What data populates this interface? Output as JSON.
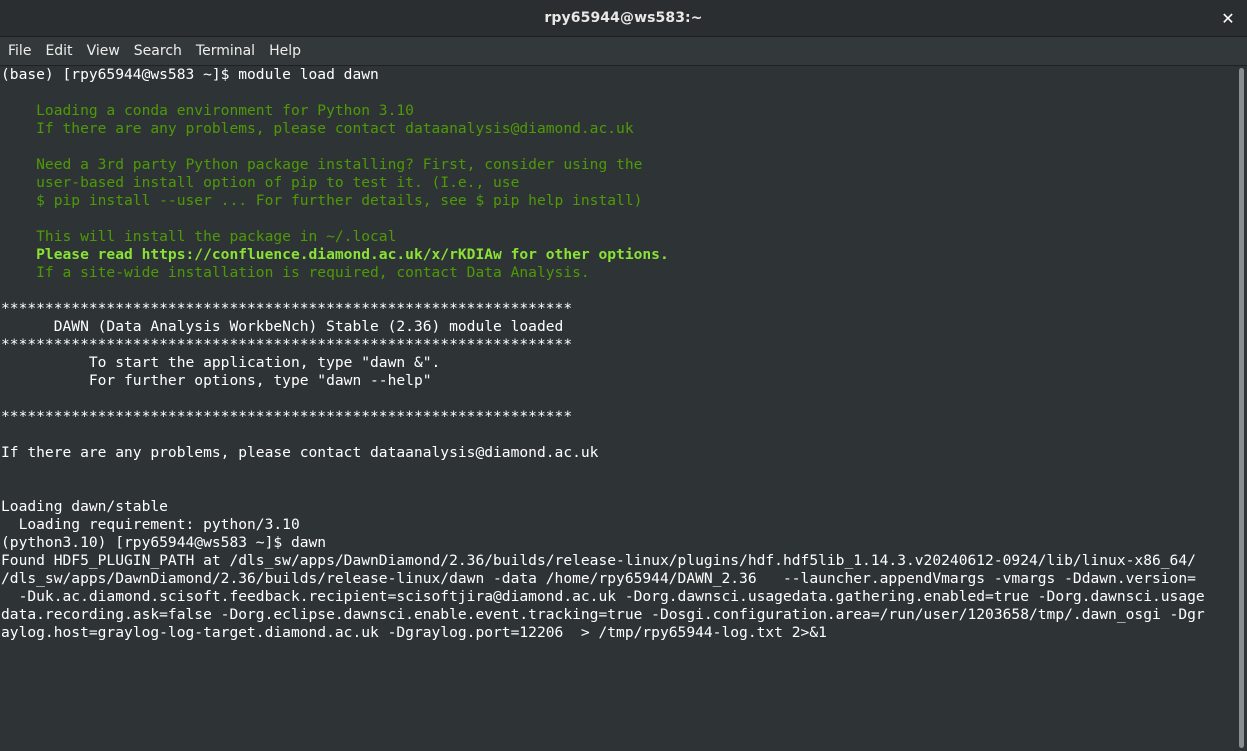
{
  "window": {
    "title": "rpy65944@ws583:~",
    "close_glyph": "✕"
  },
  "menu": [
    "File",
    "Edit",
    "View",
    "Search",
    "Terminal",
    "Help"
  ],
  "colors": {
    "background": "#2e3436",
    "text": "#ffffff",
    "green": "#4e9a06",
    "green_bright": "#8ae234"
  },
  "terminal_lines": [
    {
      "text": "(base) [rpy65944@ws583 ~]$ module load dawn",
      "style": "normal"
    },
    {
      "text": "",
      "style": "normal"
    },
    {
      "text": "    Loading a conda environment for Python 3.10",
      "style": "green"
    },
    {
      "text": "    If there are any problems, please contact dataanalysis@diamond.ac.uk",
      "style": "green"
    },
    {
      "text": "",
      "style": "normal"
    },
    {
      "text": "    Need a 3rd party Python package installing? First, consider using the",
      "style": "green"
    },
    {
      "text": "    user-based install option of pip to test it. (I.e., use",
      "style": "green"
    },
    {
      "text": "    $ pip install --user ... For further details, see $ pip help install)",
      "style": "green"
    },
    {
      "text": "",
      "style": "normal"
    },
    {
      "text": "    This will install the package in ~/.local",
      "style": "green"
    },
    {
      "text": "    Please read https://confluence.diamond.ac.uk/x/rKDIAw for other options.",
      "style": "green-bold"
    },
    {
      "text": "    If a site-wide installation is required, contact Data Analysis.",
      "style": "green"
    },
    {
      "text": "",
      "style": "normal"
    },
    {
      "text": "*****************************************************************",
      "style": "normal"
    },
    {
      "text": "      DAWN (Data Analysis WorkbeNch) Stable (2.36) module loaded",
      "style": "normal"
    },
    {
      "text": "*****************************************************************",
      "style": "normal"
    },
    {
      "text": "          To start the application, type \"dawn &\".",
      "style": "normal"
    },
    {
      "text": "          For further options, type \"dawn --help\"",
      "style": "normal"
    },
    {
      "text": "",
      "style": "normal"
    },
    {
      "text": "*****************************************************************",
      "style": "normal"
    },
    {
      "text": "",
      "style": "normal"
    },
    {
      "text": "If there are any problems, please contact dataanalysis@diamond.ac.uk",
      "style": "normal"
    },
    {
      "text": "",
      "style": "normal"
    },
    {
      "text": "",
      "style": "normal"
    },
    {
      "text": "Loading dawn/stable",
      "style": "normal"
    },
    {
      "text": "  Loading requirement: python/3.10",
      "style": "normal"
    },
    {
      "text": "(python3.10) [rpy65944@ws583 ~]$ dawn",
      "style": "normal"
    },
    {
      "text": "Found HDF5_PLUGIN_PATH at /dls_sw/apps/DawnDiamond/2.36/builds/release-linux/plugins/hdf.hdf5lib_1.14.3.v20240612-0924/lib/linux-x86_64/",
      "style": "normal"
    },
    {
      "text": "/dls_sw/apps/DawnDiamond/2.36/builds/release-linux/dawn -data /home/rpy65944/DAWN_2.36   --launcher.appendVmargs -vmargs -Ddawn.version=",
      "style": "normal"
    },
    {
      "text": "  -Duk.ac.diamond.scisoft.feedback.recipient=scisoftjira@diamond.ac.uk -Dorg.dawnsci.usagedata.gathering.enabled=true -Dorg.dawnsci.usage",
      "style": "normal"
    },
    {
      "text": "data.recording.ask=false -Dorg.eclipse.dawnsci.enable.event.tracking=true -Dosgi.configuration.area=/run/user/1203658/tmp/.dawn_osgi -Dgr",
      "style": "normal"
    },
    {
      "text": "aylog.host=graylog-log-target.diamond.ac.uk -Dgraylog.port=12206  > /tmp/rpy65944-log.txt 2>&1",
      "style": "normal"
    }
  ]
}
